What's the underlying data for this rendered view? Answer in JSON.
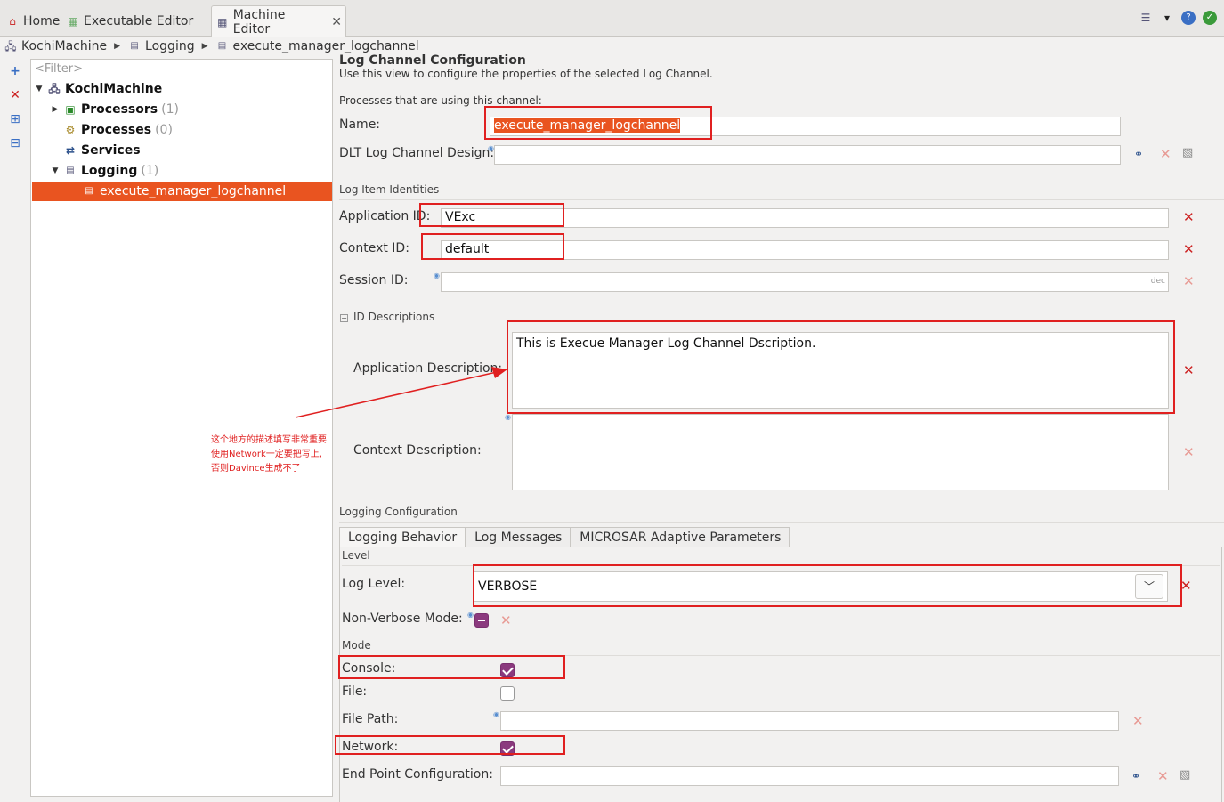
{
  "tabs": [
    {
      "label": "Home",
      "icon": "home-icon"
    },
    {
      "label": "Executable Editor",
      "icon": "editor-icon"
    },
    {
      "label": "Machine Editor",
      "icon": "editor-icon",
      "active": true
    }
  ],
  "breadcrumb": [
    "KochiMachine",
    "Logging",
    "execute_manager_logchannel"
  ],
  "tree": {
    "filter_placeholder": "<Filter>",
    "root": "KochiMachine",
    "processors": {
      "label": "Processors",
      "count": "(1)"
    },
    "processes": {
      "label": "Processes",
      "count": "(0)"
    },
    "services": {
      "label": "Services"
    },
    "logging": {
      "label": "Logging",
      "count": "(1)"
    },
    "selected": "execute_manager_logchannel"
  },
  "form": {
    "title": "Log Channel Configuration",
    "subtitle": "Use this view to configure the properties of the selected Log Channel.",
    "processes_using": "Processes that are using this channel: -",
    "name_label": "Name:",
    "name_value": "execute_manager_logchannel",
    "dlt_label": "DLT Log Channel Design:",
    "dlt_value": "",
    "log_item_identities": "Log Item Identities",
    "app_id_label": "Application ID:",
    "app_id_value": "VExc",
    "context_id_label": "Context ID:",
    "context_id_value": "default",
    "session_id_label": "Session ID:",
    "session_id_value": "",
    "session_unit": "dec",
    "id_descriptions": "ID Descriptions",
    "app_desc_label": "Application Description:",
    "app_desc_value": "This is Execue Manager Log Channel Dscription.",
    "ctx_desc_label": "Context Description:",
    "ctx_desc_value": "",
    "logging_config": "Logging Configuration",
    "subtabs": [
      "Logging Behavior",
      "Log Messages",
      "MICROSAR Adaptive Parameters"
    ],
    "level_section": "Level",
    "log_level_label": "Log Level:",
    "log_level_value": "VERBOSE",
    "non_verbose_label": "Non-Verbose Mode:",
    "mode_section": "Mode",
    "console_label": "Console:",
    "console_checked": true,
    "file_label": "File:",
    "file_checked": false,
    "file_path_label": "File Path:",
    "file_path_value": "",
    "network_label": "Network:",
    "network_checked": true,
    "endpoint_label": "End Point Configuration:",
    "endpoint_value": ""
  },
  "annotation": {
    "lines": [
      "这个地方的描述填写非常重要",
      "使用Network一定要把写上,",
      "否则Davince生成不了"
    ]
  },
  "colors": {
    "selection": "#e95420",
    "annotation": "#e02020",
    "checkbox": "#8b3a7e"
  }
}
